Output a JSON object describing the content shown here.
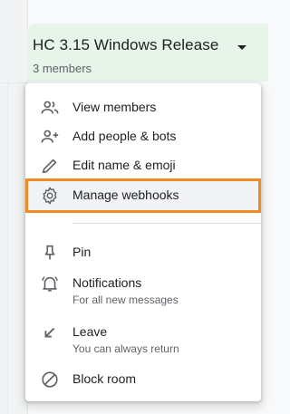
{
  "header": {
    "room_title": "HC 3.15 Windows Release",
    "members_count": "3 members"
  },
  "menu": {
    "items": [
      {
        "label": "View members",
        "icon": "people-icon"
      },
      {
        "label": "Add people & bots",
        "icon": "person-add-icon"
      },
      {
        "label": "Edit name & emoji",
        "icon": "pencil-icon"
      },
      {
        "label": "Manage webhooks",
        "icon": "gear-icon",
        "highlighted": true
      },
      {
        "label": "Pin",
        "icon": "pin-icon"
      },
      {
        "label": "Notifications",
        "sublabel": "For all new messages",
        "icon": "bell-icon"
      },
      {
        "label": "Leave",
        "sublabel": "You can always return",
        "icon": "leave-arrow-icon"
      },
      {
        "label": "Block room",
        "icon": "block-icon"
      }
    ]
  },
  "colors": {
    "header_bg": "#e6f4ea",
    "highlight_border": "#f08a24",
    "icon": "#5f6368",
    "text": "#202124"
  }
}
